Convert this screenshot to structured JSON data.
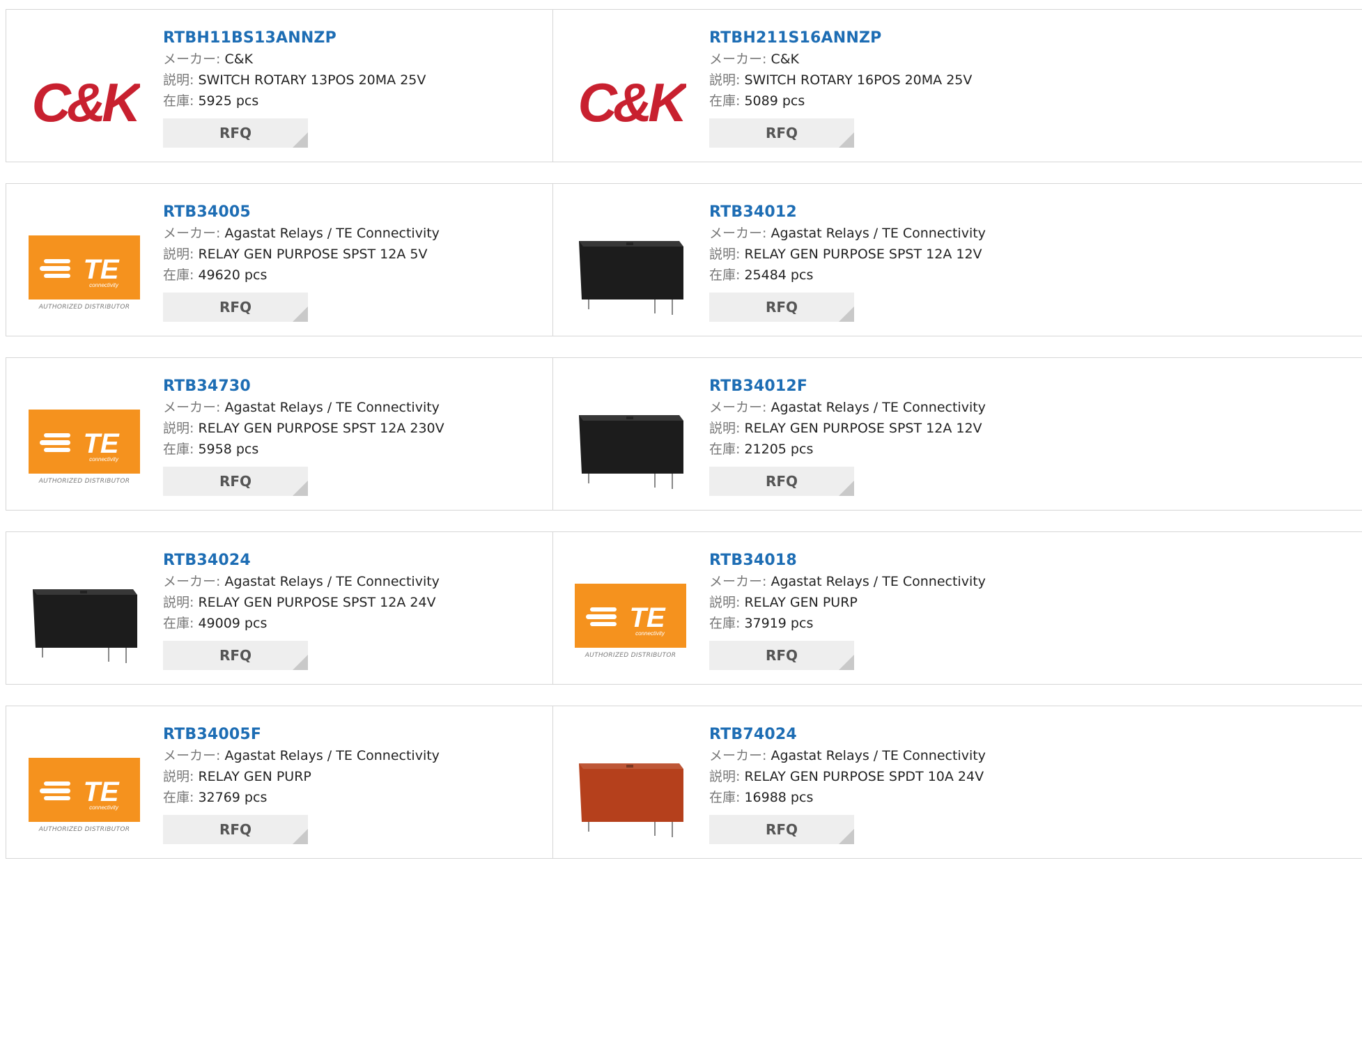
{
  "labels": {
    "maker": "メーカー:",
    "desc": "説明:",
    "stock": "在庫:",
    "rfq": "RFQ"
  },
  "te_logo": {
    "text": "TE",
    "sub": "connectivity",
    "tagline": "AUTHORIZED DISTRIBUTOR"
  },
  "ck_logo": {
    "text": "C&K"
  },
  "products": [
    {
      "pn": "RTBH11BS13ANNZP",
      "maker": "C&K",
      "desc": "SWITCH ROTARY 13POS 20MA 25V",
      "stock": "5925 pcs",
      "image": "ck-logo"
    },
    {
      "pn": "RTBH211S16ANNZP",
      "maker": "C&K",
      "desc": "SWITCH ROTARY 16POS 20MA 25V",
      "stock": "5089 pcs",
      "image": "ck-logo"
    },
    {
      "pn": "RTB34005",
      "maker": "Agastat Relays / TE Connectivity",
      "desc": "RELAY GEN PURPOSE SPST 12A 5V",
      "stock": "49620 pcs",
      "image": "te-logo"
    },
    {
      "pn": "RTB34012",
      "maker": "Agastat Relays / TE Connectivity",
      "desc": "RELAY GEN PURPOSE SPST 12A 12V",
      "stock": "25484 pcs",
      "image": "relay-black"
    },
    {
      "pn": "RTB34730",
      "maker": "Agastat Relays / TE Connectivity",
      "desc": "RELAY GEN PURPOSE SPST 12A 230V",
      "stock": "5958 pcs",
      "image": "te-logo"
    },
    {
      "pn": "RTB34012F",
      "maker": "Agastat Relays / TE Connectivity",
      "desc": "RELAY GEN PURPOSE SPST 12A 12V",
      "stock": "21205 pcs",
      "image": "relay-black"
    },
    {
      "pn": "RTB34024",
      "maker": "Agastat Relays / TE Connectivity",
      "desc": "RELAY GEN PURPOSE SPST 12A 24V",
      "stock": "49009 pcs",
      "image": "relay-black"
    },
    {
      "pn": "RTB34018",
      "maker": "Agastat Relays / TE Connectivity",
      "desc": "RELAY GEN PURP",
      "stock": "37919 pcs",
      "image": "te-logo"
    },
    {
      "pn": "RTB34005F",
      "maker": "Agastat Relays / TE Connectivity",
      "desc": "RELAY GEN PURP",
      "stock": "32769 pcs",
      "image": "te-logo"
    },
    {
      "pn": "RTB74024",
      "maker": "Agastat Relays / TE Connectivity",
      "desc": "RELAY GEN PURPOSE SPDT 10A 24V",
      "stock": "16988 pcs",
      "image": "relay-red"
    }
  ],
  "colors": {
    "link": "#1d6db4",
    "te_orange": "#f5921e",
    "ck_red": "#c8202f",
    "relay_black": "#1c1c1c",
    "relay_red": "#b5401c"
  }
}
